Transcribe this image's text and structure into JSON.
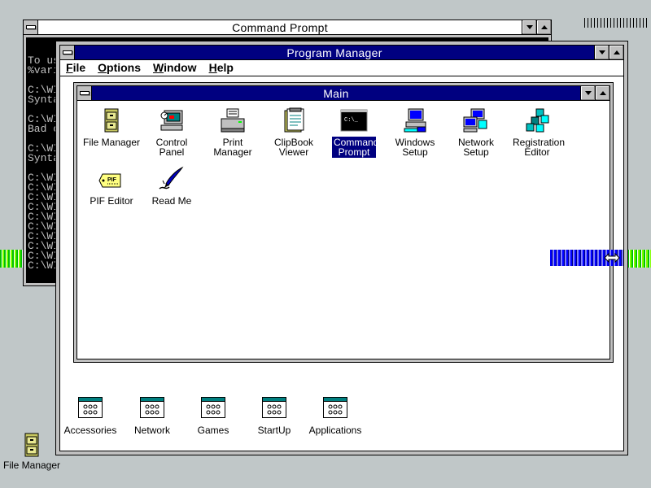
{
  "cmd": {
    "title": "Command Prompt",
    "lines": [
      "To us",
      "%vari",
      "",
      "C:\\WI",
      "Synta",
      "",
      "C:\\WI",
      "Bad c",
      "",
      "C:\\WI",
      "Synta",
      "",
      "C:\\WI",
      "C:\\WI",
      "C:\\WI",
      "C:\\WI",
      "C:\\WI",
      "C:\\WI",
      "C:\\WI",
      "C:\\WI",
      "C:\\WI",
      "C:\\WI"
    ]
  },
  "progman": {
    "title": "Program Manager",
    "menu": [
      {
        "label": "File",
        "accel": "F",
        "rest": "ile"
      },
      {
        "label": "Options",
        "accel": "O",
        "rest": "ptions"
      },
      {
        "label": "Window",
        "accel": "W",
        "rest": "indow"
      },
      {
        "label": "Help",
        "accel": "H",
        "rest": "elp"
      }
    ],
    "main": {
      "title": "Main",
      "icons": [
        {
          "label": "File Manager",
          "icon": "file-cabinet-icon"
        },
        {
          "label": "Control Panel",
          "icon": "control-panel-icon"
        },
        {
          "label": "Print Manager",
          "icon": "printer-icon"
        },
        {
          "label": "ClipBook Viewer",
          "icon": "clipbook-icon"
        },
        {
          "label": "Command Prompt",
          "icon": "ms-dos-prompt-icon",
          "selected": true
        },
        {
          "label": "Windows Setup",
          "icon": "computer-setup-icon"
        },
        {
          "label": "Network Setup",
          "icon": "network-computers-icon"
        },
        {
          "label": "Registration Editor",
          "icon": "registry-cubes-icon"
        },
        {
          "label": "PIF Editor",
          "icon": "pif-tag-icon"
        },
        {
          "label": "Read Me",
          "icon": "quill-pen-icon"
        }
      ]
    },
    "groups": [
      {
        "label": "Accessories"
      },
      {
        "label": "Network"
      },
      {
        "label": "Games"
      },
      {
        "label": "StartUp"
      },
      {
        "label": "Applications"
      }
    ]
  },
  "desktop": {
    "icons": [
      {
        "label": "File Manager",
        "icon": "file-cabinet-icon"
      }
    ]
  },
  "colors": {
    "desktop": "#c0c7c8",
    "active_title": "#000080",
    "selection": "#000080"
  }
}
